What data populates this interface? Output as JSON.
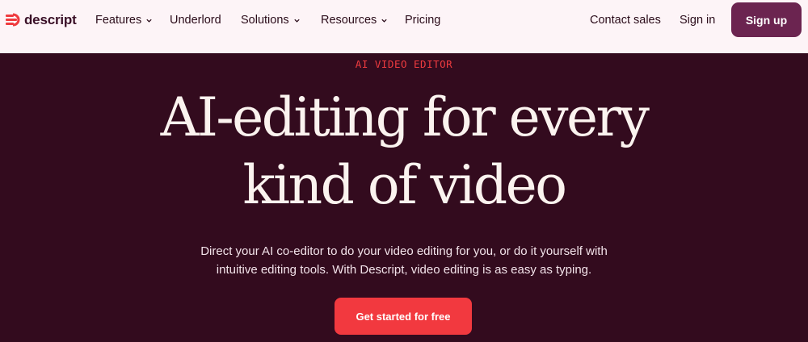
{
  "brand": {
    "name": "descript",
    "logo_icon": "descript-logo-icon",
    "accent": "#ef3b3f"
  },
  "nav": {
    "features": "Features",
    "underlord": "Underlord",
    "solutions": "Solutions",
    "resources": "Resources",
    "pricing": "Pricing",
    "contact_sales": "Contact sales",
    "sign_in": "Sign in",
    "sign_up": "Sign up",
    "dropdown_icon": "chevron-down-icon"
  },
  "hero": {
    "eyebrow": "AI VIDEO EDITOR",
    "headline_line1": "AI-editing for every",
    "headline_line2": "kind of video",
    "sub_line1": "Direct your AI co-editor to do your video editing for you, or do it yourself with",
    "sub_line2": "intuitive editing tools. With Descript, video editing is as easy as typing.",
    "cta": "Get started for free"
  },
  "colors": {
    "header_bg": "#fdf4f7",
    "hero_bg": "#330b1e",
    "signup_bg": "#6b2450",
    "cta_bg": "#f2393f"
  }
}
